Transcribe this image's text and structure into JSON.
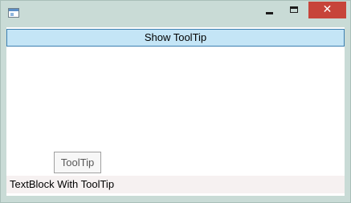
{
  "window": {
    "title": "",
    "icon": "app-window-icon",
    "controls": {
      "minimize_icon": "minimize-icon",
      "maximize_icon": "maximize-icon",
      "close_icon": "close-icon",
      "close_glyph": "✕"
    },
    "colors": {
      "frame": "#c9dbd6",
      "close_button": "#c7443a",
      "button_background": "#c4e5f6",
      "button_border": "#3c7fb1"
    }
  },
  "content": {
    "show_tooltip_button_label": "Show ToolTip",
    "tooltip_text": "ToolTip",
    "textblock_text": "TextBlock With ToolTip"
  }
}
